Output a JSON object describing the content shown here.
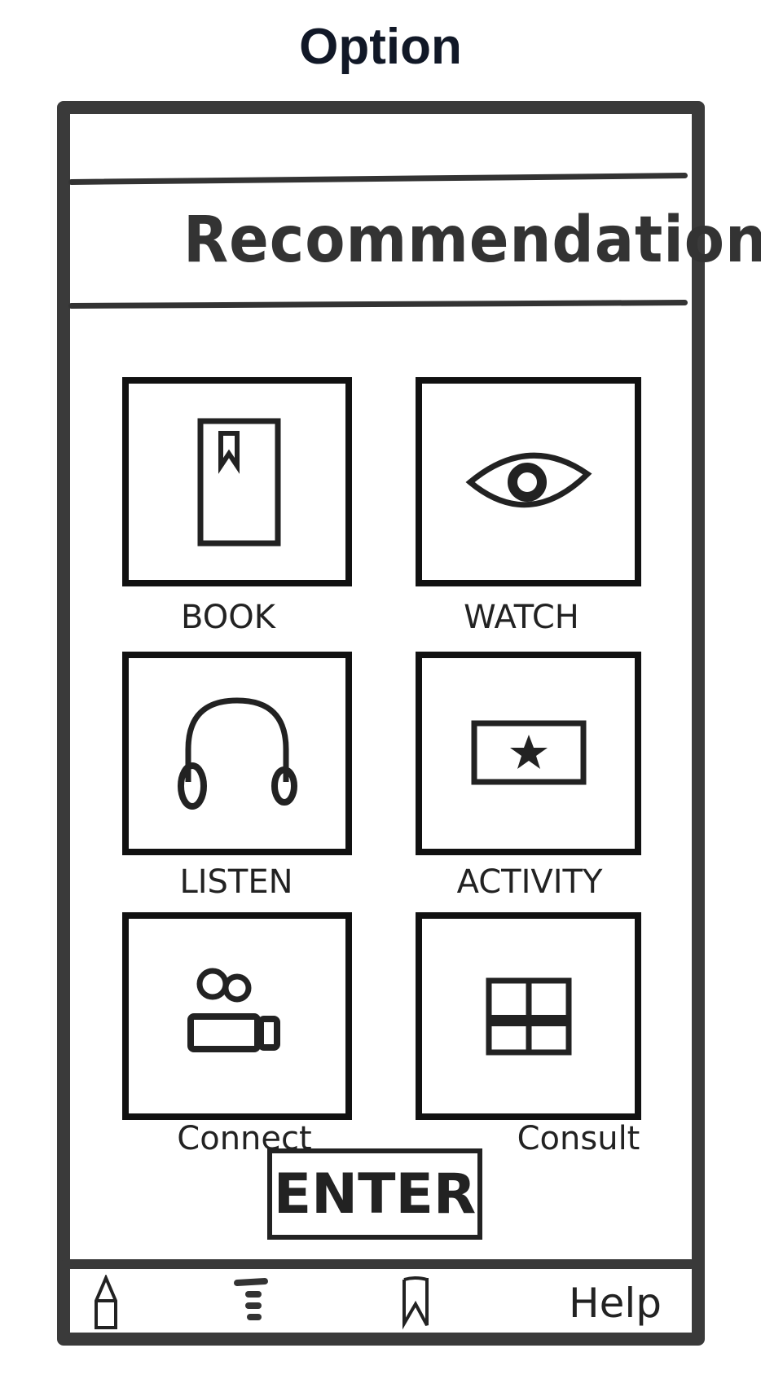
{
  "page_title": "Option",
  "header": {
    "title": "Recommendation"
  },
  "tiles": [
    {
      "label": "BOOK",
      "icon": "book-icon"
    },
    {
      "label": "WATCH",
      "icon": "eye-icon"
    },
    {
      "label": "LISTEN",
      "icon": "headphones-icon"
    },
    {
      "label": "ACTIVITY",
      "icon": "ticket-star-icon"
    },
    {
      "label": "Connect",
      "icon": "people-icon"
    },
    {
      "label": "Consult",
      "icon": "window-icon"
    }
  ],
  "enter_label": "ENTER",
  "bottom_nav": {
    "help_label": "Help"
  },
  "colors": {
    "ink": "#333333",
    "title": "#111827"
  }
}
